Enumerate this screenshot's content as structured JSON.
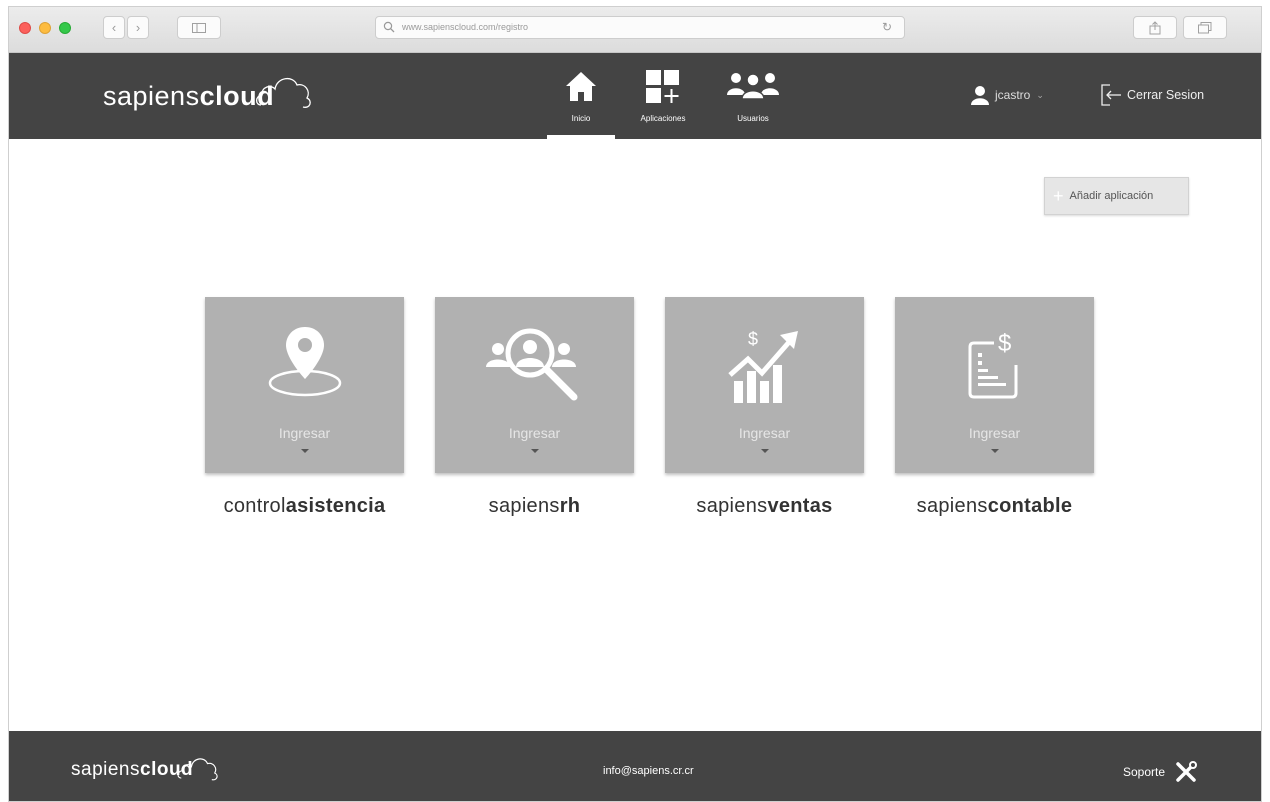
{
  "browser": {
    "url": "www.sapienscloud.com/registro"
  },
  "brand": {
    "light": "sapiens",
    "bold": "cloud"
  },
  "nav": {
    "items": [
      {
        "label": "Inicio",
        "icon": "home-icon"
      },
      {
        "label": "Aplicaciones",
        "icon": "apps-grid-icon"
      },
      {
        "label": "Usuarios",
        "icon": "users-icon"
      }
    ]
  },
  "user": {
    "name": "jcastro",
    "logout_label": "Cerrar Sesion"
  },
  "main": {
    "add_app_label": "Añadir aplicación",
    "enter_label": "Ingresar",
    "apps": [
      {
        "prefix": "control",
        "bold": "asistencia",
        "icon": "location-pin-icon"
      },
      {
        "prefix": "sapiens",
        "bold": "rh",
        "icon": "people-search-icon"
      },
      {
        "prefix": "sapiens",
        "bold": "ventas",
        "icon": "sales-growth-icon"
      },
      {
        "prefix": "sapiens",
        "bold": "contable",
        "icon": "accounting-document-icon"
      }
    ]
  },
  "footer": {
    "email": "info@sapiens.cr.cr",
    "support_label": "Soporte"
  },
  "colors": {
    "header_bg": "#444444",
    "card_bg": "#b1b1b1",
    "page_bg": "#ffffff"
  }
}
